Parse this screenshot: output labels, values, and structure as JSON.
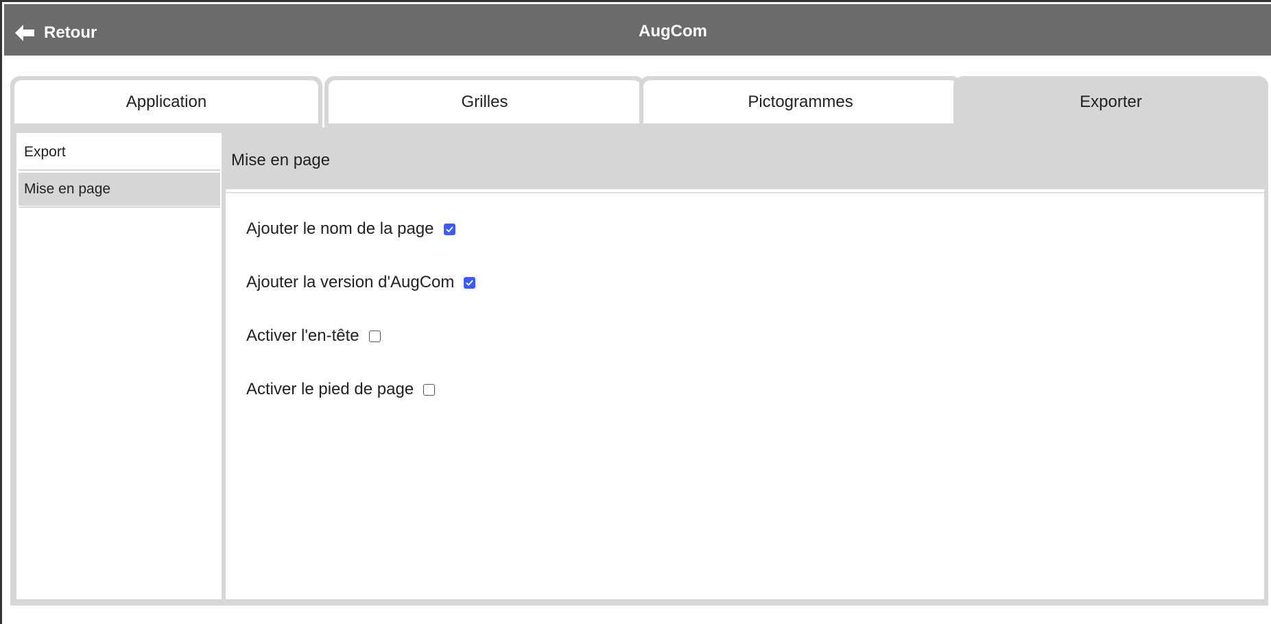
{
  "header": {
    "back_label": "Retour",
    "app_title": "AugCom"
  },
  "tabs": [
    {
      "label": "Application",
      "active": false
    },
    {
      "label": "Grilles",
      "active": false
    },
    {
      "label": "Pictogrammes",
      "active": false
    },
    {
      "label": "Exporter",
      "active": true
    }
  ],
  "sidebar": {
    "items": [
      {
        "label": "Export",
        "selected": false
      },
      {
        "label": "Mise en page",
        "selected": true
      }
    ]
  },
  "content": {
    "section_title": "Mise en page",
    "options": [
      {
        "label": "Ajouter le nom de la page",
        "checked": true
      },
      {
        "label": "Ajouter la version d'AugCom",
        "checked": true
      },
      {
        "label": "Activer l'en-tête",
        "checked": false
      },
      {
        "label": "Activer le pied de page",
        "checked": false
      }
    ]
  },
  "colors": {
    "header_bg": "#6b6b6b",
    "panel_bg": "#d6d6d6",
    "checkbox_accent": "#3d5afe"
  },
  "icons": {
    "back": "arrow-left-icon",
    "checkmark": "checkmark-icon"
  }
}
